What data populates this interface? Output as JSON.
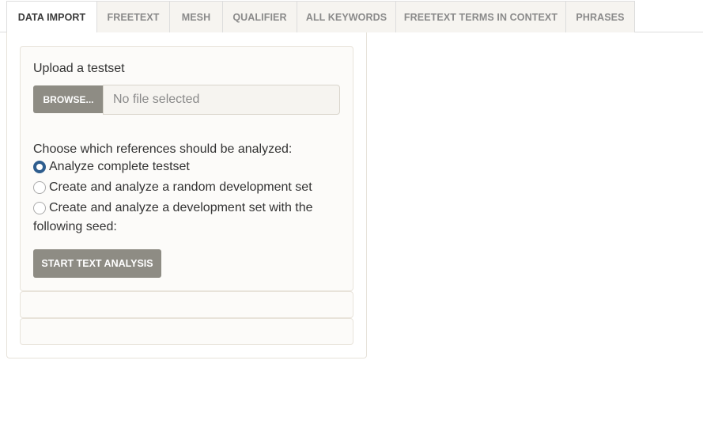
{
  "tabs": [
    {
      "label": "DATA IMPORT",
      "active": true
    },
    {
      "label": "FREETEXT",
      "active": false
    },
    {
      "label": "MESH",
      "active": false
    },
    {
      "label": "QUALIFIER",
      "active": false
    },
    {
      "label": "ALL KEYWORDS",
      "active": false
    },
    {
      "label": "FREETEXT TERMS IN CONTEXT",
      "active": false
    },
    {
      "label": "PHRASES",
      "active": false
    }
  ],
  "upload": {
    "label": "Upload a testset",
    "browse_label": "BROWSE...",
    "file_value": "No file selected"
  },
  "analysis": {
    "prompt": "Choose which references should be analyzed:",
    "options": [
      {
        "label": "Analyze complete testset",
        "selected": true
      },
      {
        "label": "Create and analyze a random development set",
        "selected": false
      },
      {
        "label_line1": "Create and analyze a development set with the",
        "label_line2": "following seed:",
        "selected": false
      }
    ],
    "start_label": "START TEXT ANALYSIS"
  },
  "colors": {
    "button_bg": "#8e8c84",
    "radio_selected": "#2e5d8e",
    "tab_inactive_bg": "#f6f4f0"
  }
}
